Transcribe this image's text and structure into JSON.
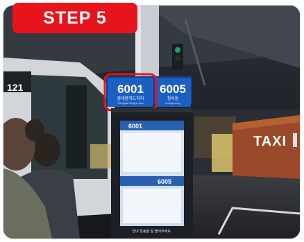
{
  "step_label": "STEP 5",
  "bus_number": "121",
  "sign_left": {
    "number": "6001",
    "sub": "충대봉하드하지",
    "sub_en": "Chungdae Bongha Stop"
  },
  "sign_right": {
    "number": "6005",
    "sub": "정사동",
    "sub_en": "Jeongsa-dong"
  },
  "screen_top_route": "6001",
  "screen_bottom_route": "6005",
  "screen_footer": "안내 방송을 잘 들어주세요.",
  "taxi_sign": "TAXI",
  "colors": {
    "badge": "#e8141b",
    "sign_blue": "#1c5fc2",
    "highlight": "#e4141b"
  }
}
